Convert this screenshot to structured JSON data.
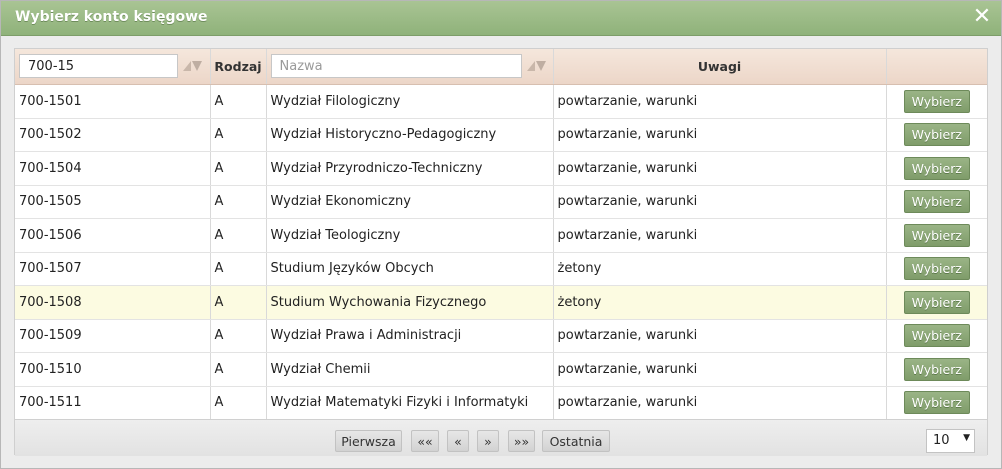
{
  "dialog": {
    "title": "Wybierz konto księgowe"
  },
  "filters": {
    "konto_value": "700-15",
    "nazwa_placeholder": "Nazwa"
  },
  "columns": {
    "rodzaj": "Rodzaj",
    "uwagi": "Uwagi"
  },
  "rows": [
    {
      "konto": "700-1501",
      "rodzaj": "A",
      "nazwa": "Wydział Filologiczny",
      "uwagi": "powtarzanie, warunki",
      "button": "Wybierz"
    },
    {
      "konto": "700-1502",
      "rodzaj": "A",
      "nazwa": "Wydział Historyczno-Pedagogiczny",
      "uwagi": "powtarzanie, warunki",
      "button": "Wybierz"
    },
    {
      "konto": "700-1504",
      "rodzaj": "A",
      "nazwa": "Wydział Przyrodniczo-Techniczny",
      "uwagi": "powtarzanie, warunki",
      "button": "Wybierz"
    },
    {
      "konto": "700-1505",
      "rodzaj": "A",
      "nazwa": "Wydział Ekonomiczny",
      "uwagi": "powtarzanie, warunki",
      "button": "Wybierz"
    },
    {
      "konto": "700-1506",
      "rodzaj": "A",
      "nazwa": "Wydział Teologiczny",
      "uwagi": "powtarzanie, warunki",
      "button": "Wybierz"
    },
    {
      "konto": "700-1507",
      "rodzaj": "A",
      "nazwa": "Studium Języków Obcych",
      "uwagi": "żetony",
      "button": "Wybierz"
    },
    {
      "konto": "700-1508",
      "rodzaj": "A",
      "nazwa": "Studium Wychowania Fizycznego",
      "uwagi": "żetony",
      "button": "Wybierz"
    },
    {
      "konto": "700-1509",
      "rodzaj": "A",
      "nazwa": "Wydział Prawa i Administracji",
      "uwagi": "powtarzanie, warunki",
      "button": "Wybierz"
    },
    {
      "konto": "700-1510",
      "rodzaj": "A",
      "nazwa": "Wydział Chemii",
      "uwagi": "powtarzanie, warunki",
      "button": "Wybierz"
    },
    {
      "konto": "700-1511",
      "rodzaj": "A",
      "nazwa": "Wydział Matematyki Fizyki i Informatyki",
      "uwagi": "powtarzanie, warunki",
      "button": "Wybierz"
    }
  ],
  "pager": {
    "first": "Pierwsza",
    "prev_block": "««",
    "prev": "«",
    "next": "»",
    "next_block": "»»",
    "last": "Ostatnia",
    "page_size": "10"
  },
  "colors": {
    "titlebar": "#9bbb86",
    "header": "#f0ddd0",
    "highlight_row": "#fcfbe1",
    "button": "#86a472"
  },
  "icons": {
    "close": "close-icon",
    "sort": "sort-icon",
    "select_arrow": "chevron-down-icon"
  }
}
